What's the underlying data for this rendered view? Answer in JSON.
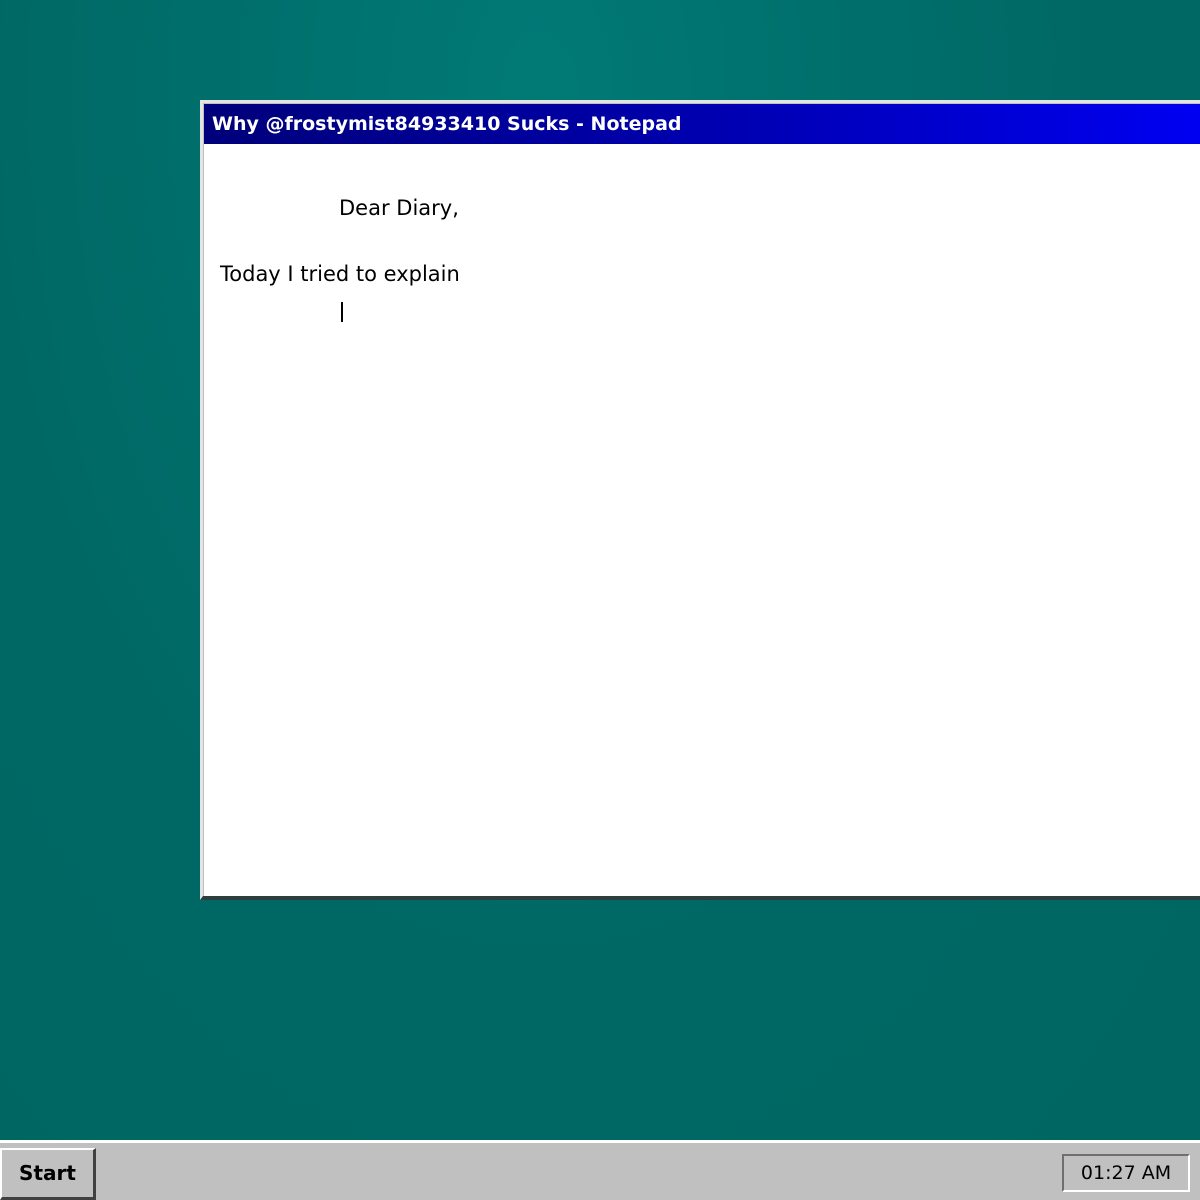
{
  "window": {
    "title": "Why @frostymist84933410 Sucks - Notepad"
  },
  "document": {
    "lines": [
      "Dear Diary,",
      "Today I tried to explain"
    ]
  },
  "taskbar": {
    "start_label": "Start",
    "clock": "01:27 AM"
  },
  "colors": {
    "desktop": "#00706d",
    "titlebar_start": "#00007a",
    "titlebar_end": "#0000f2",
    "taskbar": "#c0c0c0"
  }
}
